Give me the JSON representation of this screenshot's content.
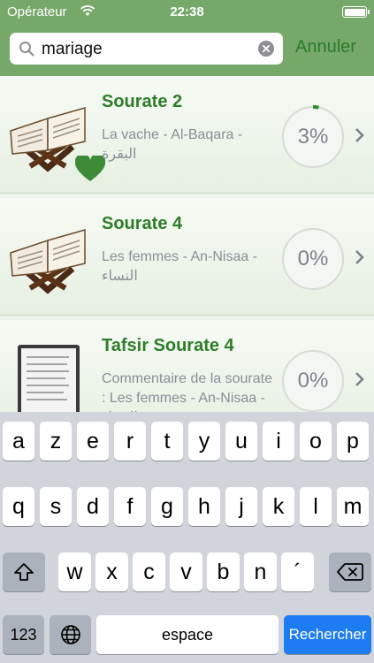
{
  "status_bar": {
    "carrier": "Opérateur",
    "time": "22:38"
  },
  "search": {
    "query": "mariage",
    "cancel_label": "Annuler"
  },
  "results": [
    {
      "title": "Sourate 2",
      "subtitle": "La vache - Al-Baqara - البقرة",
      "progress_percent": 3,
      "progress_label": "3%",
      "favorite": true,
      "thumb_icon": "quran-book-icon"
    },
    {
      "title": "Sourate 4",
      "subtitle": "Les femmes - An-Nisaa - النساء",
      "progress_percent": 0,
      "progress_label": "0%",
      "favorite": false,
      "thumb_icon": "quran-book-icon"
    },
    {
      "title": "Tafsir Sourate 4",
      "subtitle": "Commentaire de la sourate : Les femmes - An-Nisaa - النساء",
      "progress_percent": 0,
      "progress_label": "0%",
      "favorite": false,
      "thumb_icon": "document-icon"
    }
  ],
  "keyboard": {
    "row1": [
      "a",
      "z",
      "e",
      "r",
      "t",
      "y",
      "u",
      "i",
      "o",
      "p"
    ],
    "row2": [
      "q",
      "s",
      "d",
      "f",
      "g",
      "h",
      "j",
      "k",
      "l",
      "m"
    ],
    "row3": [
      "w",
      "x",
      "c",
      "v",
      "b",
      "n",
      "´"
    ],
    "numbers_label": "123",
    "space_label": "espace",
    "return_label": "Rechercher"
  },
  "colors": {
    "accent": "#2e7d2a",
    "nav_bar": "#76a86a",
    "return_key": "#1e7cf2"
  }
}
